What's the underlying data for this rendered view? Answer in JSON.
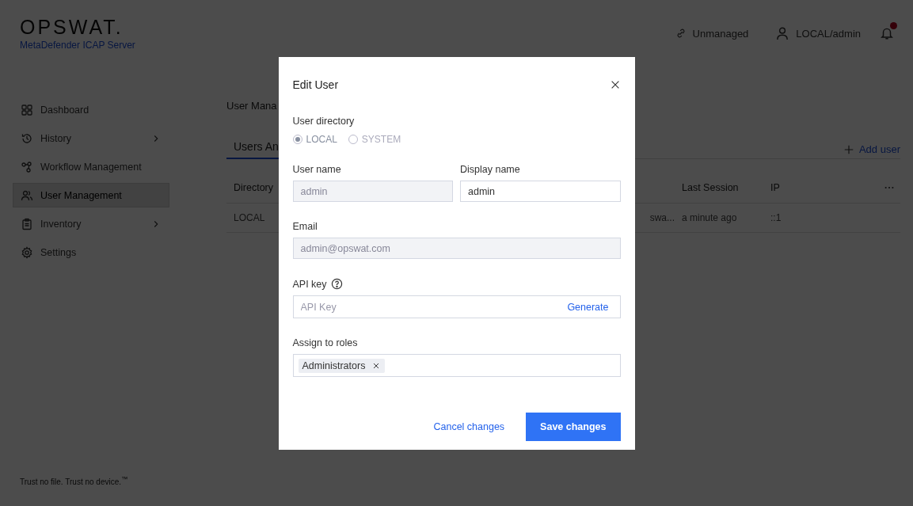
{
  "header": {
    "logo": "OPSWAT.",
    "product": "MetaDefender ICAP Server",
    "status": "Unmanaged",
    "user": "LOCAL/admin",
    "notification": true
  },
  "sidebar": {
    "items": [
      {
        "label": "Dashboard",
        "selected": false,
        "expandable": false
      },
      {
        "label": "History",
        "selected": false,
        "expandable": true
      },
      {
        "label": "Workflow Management",
        "selected": false,
        "expandable": false
      },
      {
        "label": "User Management",
        "selected": true,
        "expandable": false
      },
      {
        "label": "Inventory",
        "selected": false,
        "expandable": true
      },
      {
        "label": "Settings",
        "selected": false,
        "expandable": false
      }
    ]
  },
  "footer": "Trust no file. Trust no device.$^{™}$",
  "page": {
    "title": "User Mana",
    "tabs": [
      {
        "label": "Users An",
        "selected": true
      }
    ],
    "add_button": "Add user",
    "table": {
      "columns": [
        "Directory",
        "Last Session",
        "IP"
      ],
      "rows": [
        {
          "directory": "LOCAL",
          "column_2": "swa...",
          "last_session": "a minute ago",
          "ip": "::1"
        }
      ]
    }
  },
  "dialog": {
    "title": "Edit User",
    "directory": {
      "label": "User directory",
      "disabled": true,
      "options": [
        {
          "label": "LOCAL",
          "selected": true
        },
        {
          "label": "SYSTEM",
          "selected": false
        }
      ]
    },
    "user_name": {
      "label": "User name",
      "value": "admin",
      "disabled": true
    },
    "display_name": {
      "label": "Display name",
      "value": "admin",
      "disabled": false
    },
    "email": {
      "label": "Email",
      "value": "admin@opswat.com",
      "disabled": true
    },
    "api_key": {
      "label": "API key",
      "placeholder": "API Key",
      "action": "Generate"
    },
    "roles": {
      "label": "Assign to roles",
      "tags": [
        "Administrators"
      ]
    },
    "cancel": "Cancel changes",
    "save": "Save changes"
  }
}
